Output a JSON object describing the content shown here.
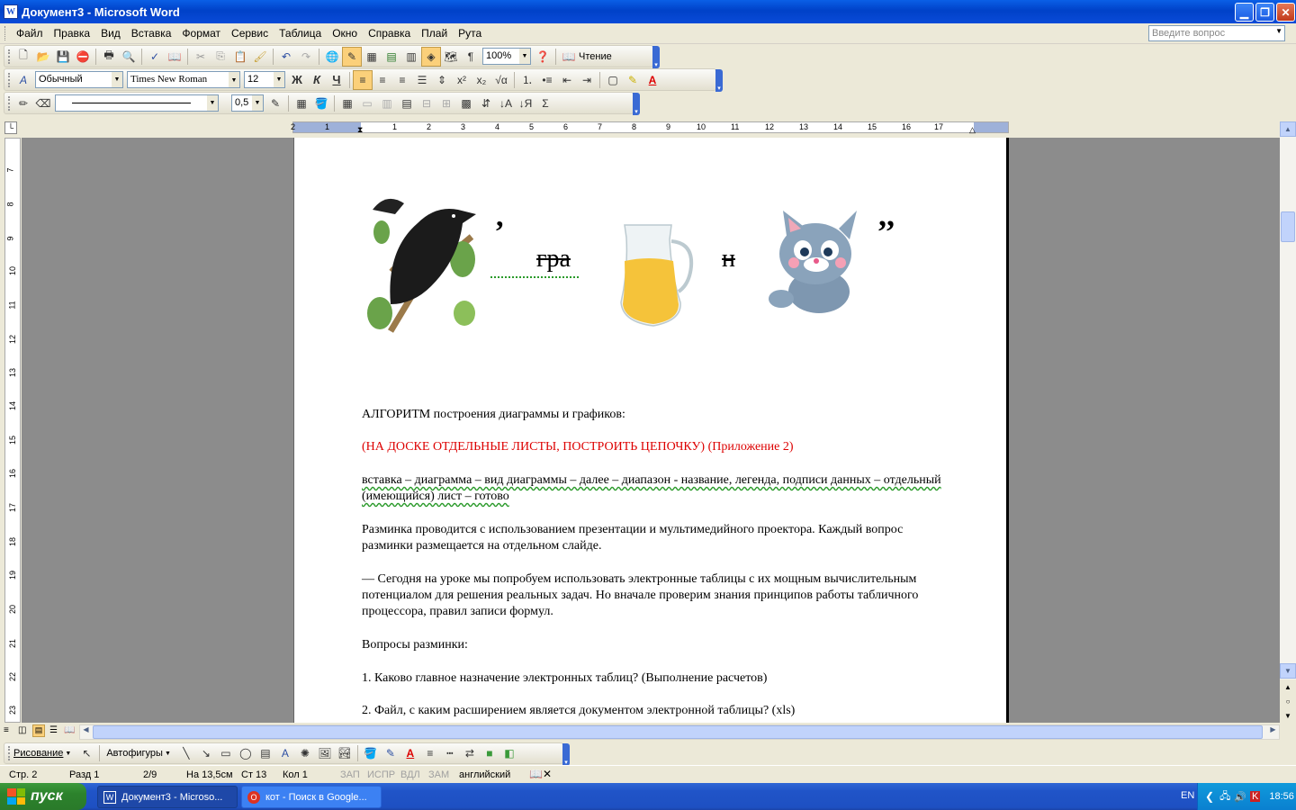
{
  "window": {
    "title": "Документ3 - Microsoft Word",
    "app_icon": "W"
  },
  "menu": {
    "items": [
      "Файл",
      "Правка",
      "Вид",
      "Вставка",
      "Формат",
      "Сервис",
      "Таблица",
      "Окно",
      "Справка",
      "Плай",
      "Рута"
    ],
    "ask_placeholder": "Введите вопрос"
  },
  "toolbar_standard": {
    "zoom": "100%",
    "reading_label": "Чтение"
  },
  "toolbar_formatting": {
    "style": "Обычный",
    "font": "Times New Roman",
    "size": "12",
    "bold": "Ж",
    "italic": "К",
    "underline": "Ч"
  },
  "toolbar_tables": {
    "line_weight": "0,5"
  },
  "ruler": {
    "h_numbers": [
      "2",
      "1",
      "1",
      "2",
      "3",
      "4",
      "5",
      "6",
      "7",
      "8",
      "9",
      "10",
      "11",
      "12",
      "13",
      "14",
      "15",
      "16",
      "17"
    ],
    "v_numbers": [
      "7",
      "8",
      "9",
      "10",
      "11",
      "12",
      "13",
      "14",
      "15",
      "16",
      "17",
      "18",
      "19",
      "20",
      "21",
      "22",
      "23"
    ]
  },
  "document": {
    "rebus": {
      "comma_1": ",",
      "crossed_text": "гра",
      "letter_n": "н",
      "quotes": ",,"
    },
    "paragraphs": [
      {
        "text": "АЛГОРИТМ построения диаграммы и графиков:",
        "color": "#000000"
      },
      {
        "text": "(НА ДОСКЕ ОТДЕЛЬНЫЕ ЛИСТЫ, ПОСТРОИТЬ ЦЕПОЧКУ) (Приложение 2)",
        "color": "#d00000"
      },
      {
        "text": "вставка – диаграмма – вид диаграммы – далее – диапазон - название, легенда, подписи данных – отдельный (имеющийся) лист – готово",
        "color": "#000000"
      },
      {
        "text": "Разминка проводится с использованием презентации и мультимедийного проектора. Каждый вопрос разминки размещается на отдельном слайде.",
        "color": "#000000"
      },
      {
        "text": "— Сегодня на уроке мы попробуем использовать электронные таблицы с их мощным вычислительным потенциалом для решения реальных задач. Но вначале проверим знания принципов работы табличного процессора, правил записи формул.",
        "color": "#000000"
      },
      {
        "text": "Вопросы разминки:",
        "color": "#000000"
      },
      {
        "text": "1. Каково главное назначение электронных таблиц? (Выполнение расчетов)",
        "color": "#000000"
      },
      {
        "text": "2. Файл, с каким расширением является документом электронной таблицы? (xls)",
        "color": "#000000"
      }
    ]
  },
  "drawing_toolbar": {
    "drawing_label": "Рисование",
    "autoshapes_label": "Автофигуры"
  },
  "status": {
    "page": "Стр. 2",
    "section": "Разд 1",
    "pages": "2/9",
    "at": "На 13,5см",
    "line": "Ст 13",
    "col": "Кол 1",
    "rec": "ЗАП",
    "trk": "ИСПР",
    "ext": "ВДЛ",
    "ovr": "ЗАМ",
    "lang": "английский"
  },
  "taskbar": {
    "start_label": "пуск",
    "tasks": [
      "Документ3 - Microso...",
      "кот - Поиск в Google..."
    ],
    "lang": "EN",
    "time": "18:56"
  }
}
